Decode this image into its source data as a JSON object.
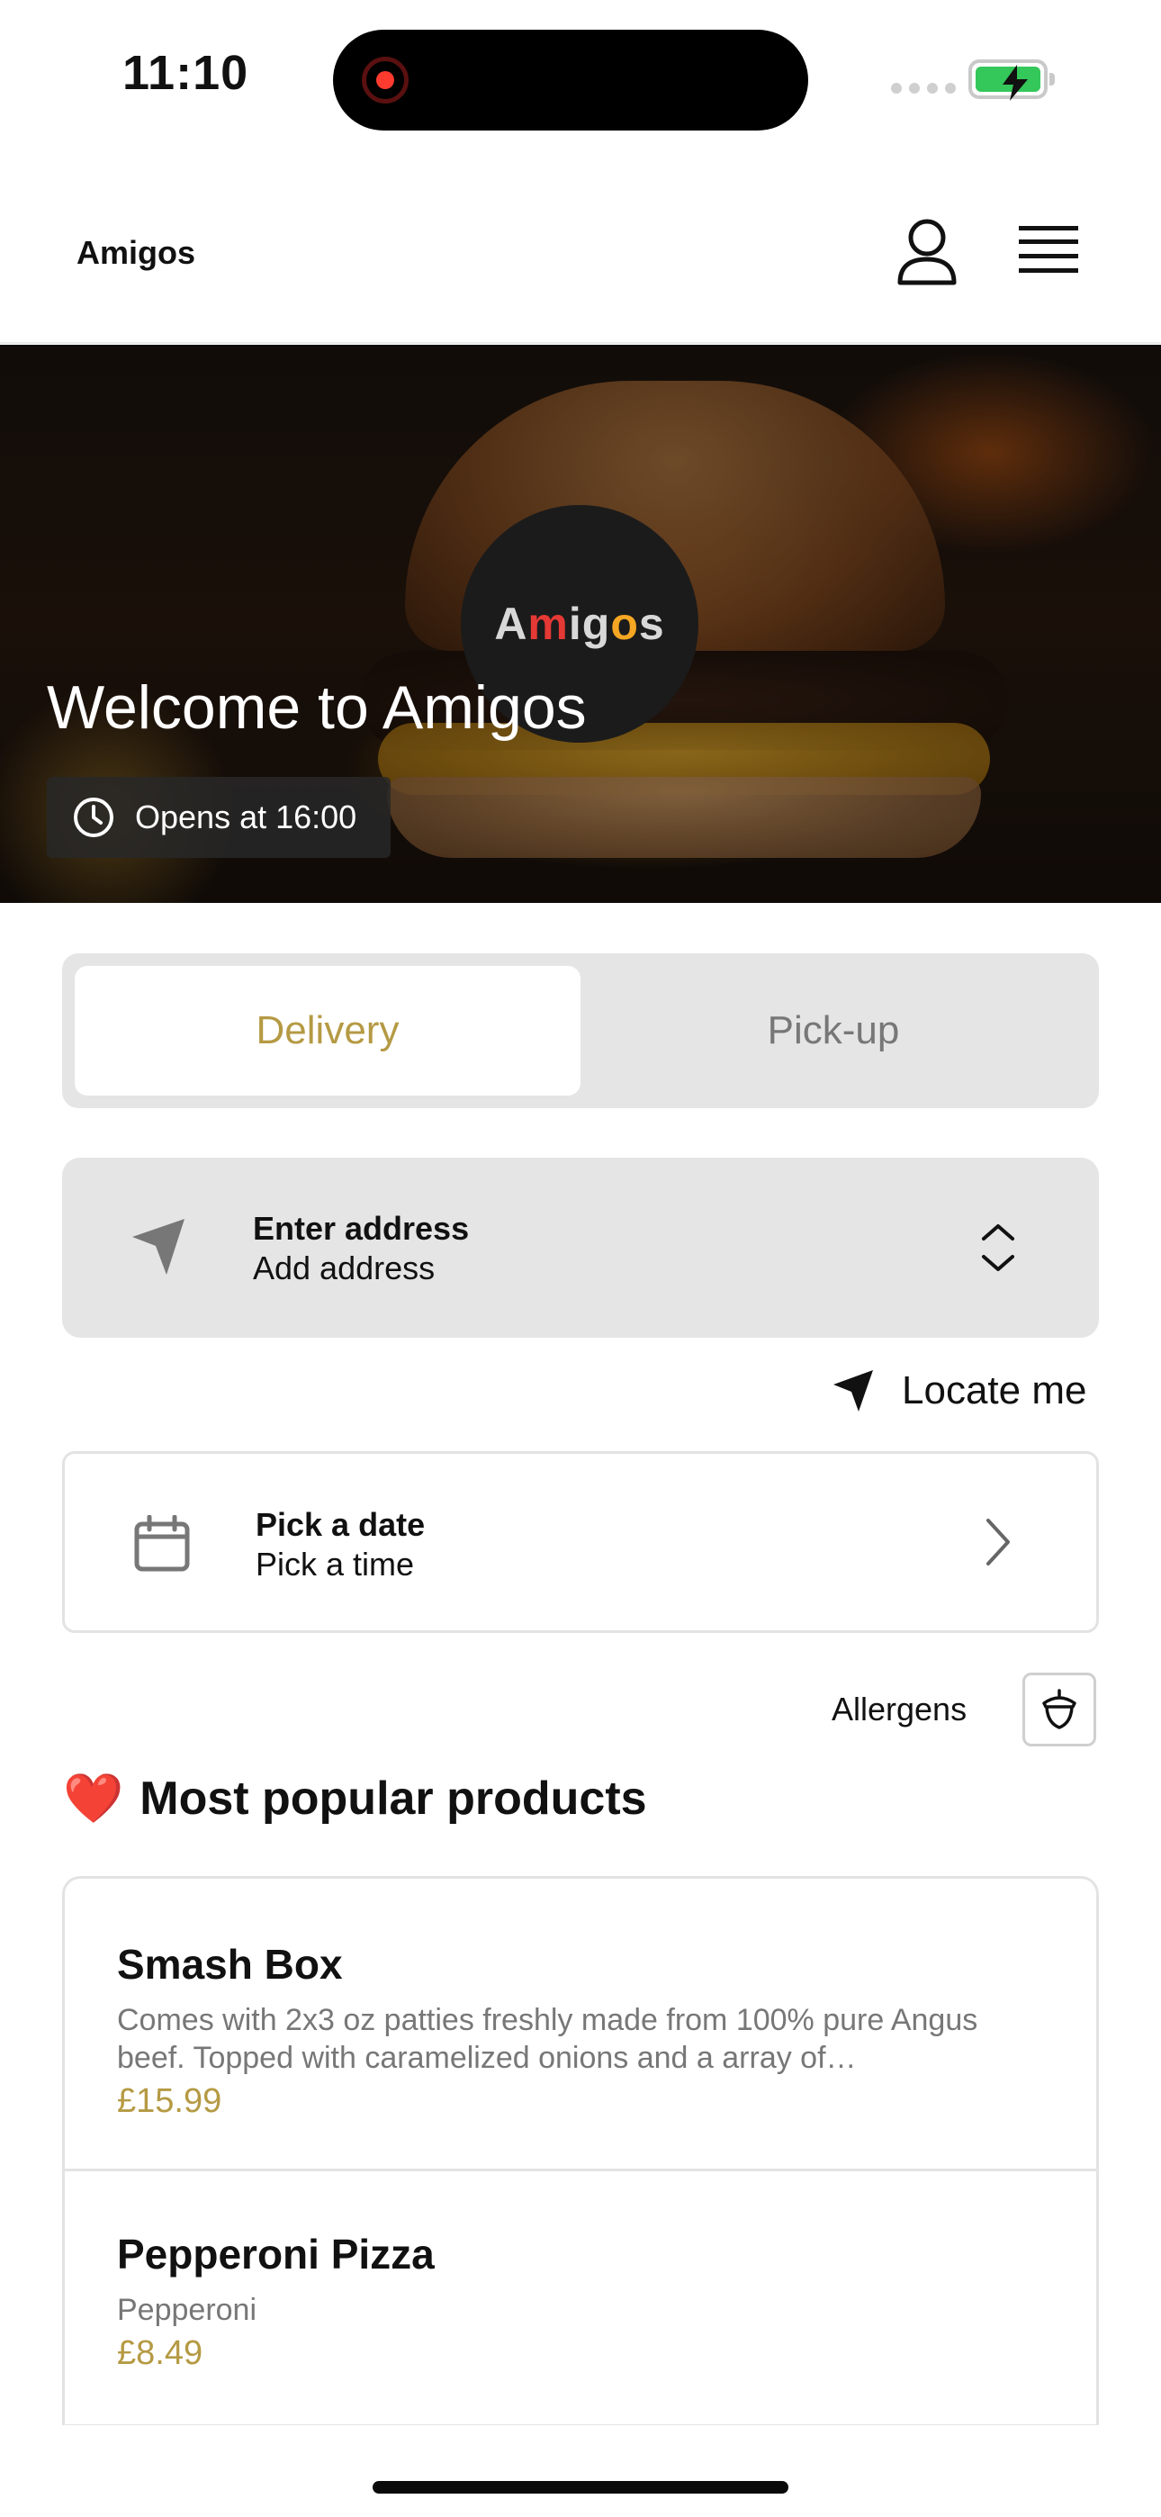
{
  "status_bar": {
    "time": "11:10"
  },
  "header": {
    "brand": "Amigos"
  },
  "hero": {
    "logo_prefix": "A",
    "logo_m": "m",
    "logo_mid": "ig",
    "logo_o": "o",
    "logo_suffix": "s",
    "title": "Welcome to Amigos",
    "opens_text": "Opens at 16:00"
  },
  "order_mode": {
    "tabs": [
      {
        "label": "Delivery",
        "selected": true
      },
      {
        "label": "Pick-up",
        "selected": false
      }
    ]
  },
  "address": {
    "title": "Enter address",
    "subtitle": "Add address"
  },
  "locate": {
    "label": "Locate me"
  },
  "schedule": {
    "title": "Pick a date",
    "subtitle": "Pick a time"
  },
  "allergens": {
    "label": "Allergens"
  },
  "popular": {
    "heart": "❤️",
    "title": "Most popular products",
    "products": [
      {
        "name": "Smash Box",
        "description": "Comes with 2x3 oz patties freshly made from 100% pure Angus beef. Topped with caramelized onions and a array of…",
        "price": "£15.99"
      },
      {
        "name": "Pepperoni Pizza",
        "description": "Pepperoni",
        "price": "£8.49"
      }
    ]
  },
  "colors": {
    "accent_gold": "#b59a44",
    "battery_green": "#34c759",
    "record_red": "#ff3b30",
    "segment_bg": "#e5e5e5"
  }
}
